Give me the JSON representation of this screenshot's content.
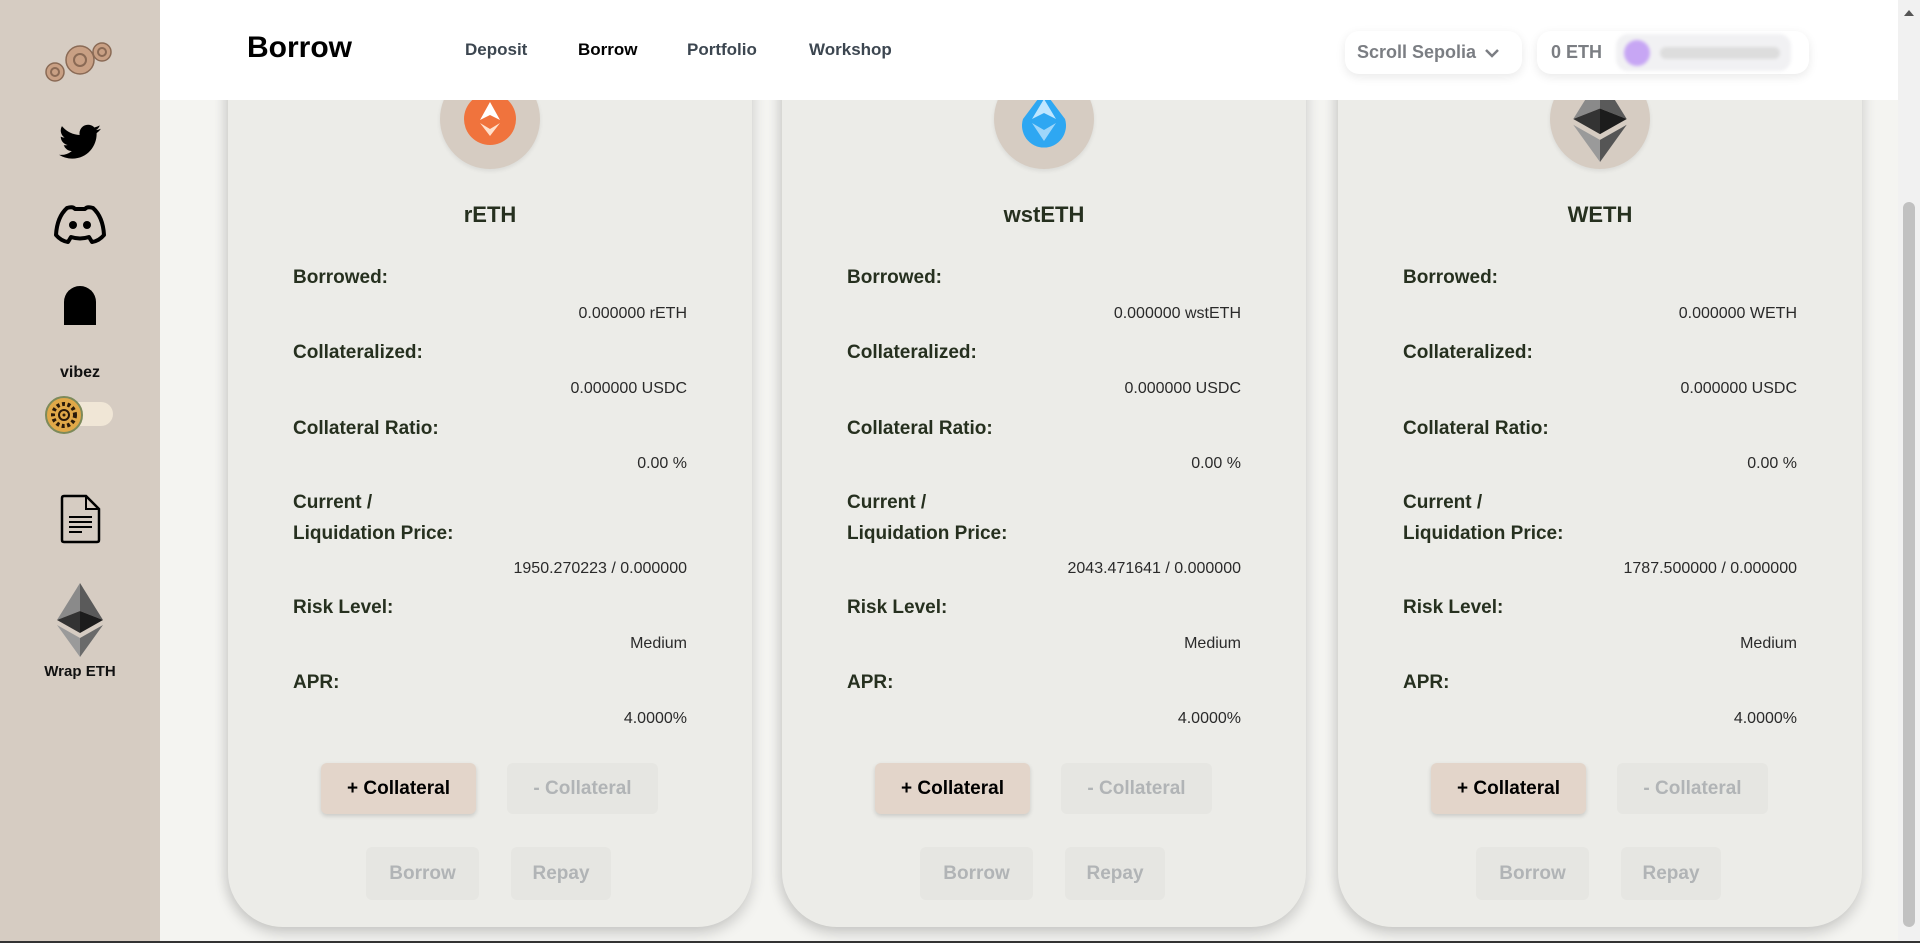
{
  "sidebar": {
    "logo_icon": "gears-logo",
    "items": [
      {
        "icon": "twitter-icon"
      },
      {
        "icon": "discord-icon"
      },
      {
        "icon": "ghost-icon"
      },
      {
        "label": "vibez",
        "toggle": "gear-toggle",
        "toggle_on": false
      },
      {
        "icon": "document-icon"
      },
      {
        "icon": "ethereum-icon",
        "label": "Wrap ETH"
      }
    ]
  },
  "header": {
    "title": "Borrow",
    "nav": [
      {
        "label": "Deposit",
        "active": false
      },
      {
        "label": "Borrow",
        "active": true
      },
      {
        "label": "Portfolio",
        "active": false
      },
      {
        "label": "Workshop",
        "active": false
      }
    ],
    "network": "Scroll Sepolia",
    "balance": "0 ETH"
  },
  "labels": {
    "borrowed": "Borrowed:",
    "collateralized": "Collateralized:",
    "ratio": "Collateral Ratio:",
    "price_1": "Current /",
    "price_2": "Liquidation Price:",
    "risk": "Risk Level:",
    "apr": "APR:",
    "add_collateral": "+ Collateral",
    "remove_collateral": "- Collateral",
    "borrow": "Borrow",
    "repay": "Repay"
  },
  "cards": [
    {
      "token": "rETH",
      "icon_color": "#f0733d",
      "borrowed": "0.000000 rETH",
      "collateralized": "0.000000 USDC",
      "ratio": "0.00 %",
      "price": "1950.270223 / 0.000000",
      "risk": "Medium",
      "apr": "4.0000%"
    },
    {
      "token": "wstETH",
      "icon_color": "#2ea7f2",
      "borrowed": "0.000000 wstETH",
      "collateralized": "0.000000 USDC",
      "ratio": "0.00 %",
      "price": "2043.471641 / 0.000000",
      "risk": "Medium",
      "apr": "4.0000%"
    },
    {
      "token": "WETH",
      "icon_color": "#222222",
      "borrowed": "0.000000 WETH",
      "collateralized": "0.000000 USDC",
      "ratio": "0.00 %",
      "price": "1787.500000 / 0.000000",
      "risk": "Medium",
      "apr": "4.0000%"
    }
  ]
}
